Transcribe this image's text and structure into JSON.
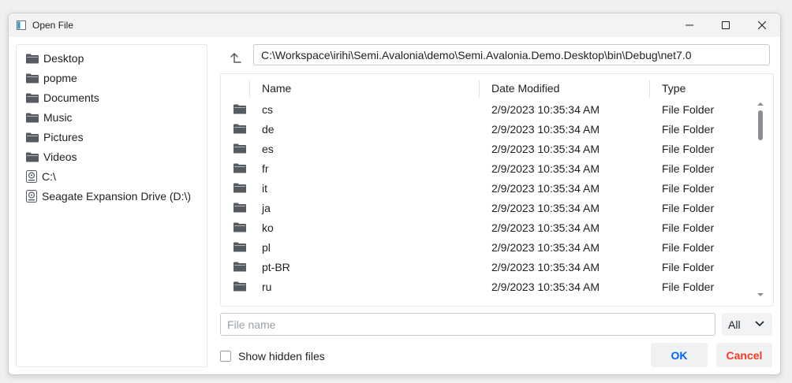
{
  "window": {
    "title": "Open File"
  },
  "sidebar": {
    "items": [
      {
        "label": "Desktop",
        "icon": "folder-icon"
      },
      {
        "label": "popme",
        "icon": "folder-icon"
      },
      {
        "label": "Documents",
        "icon": "folder-icon"
      },
      {
        "label": "Music",
        "icon": "folder-icon"
      },
      {
        "label": "Pictures",
        "icon": "folder-icon"
      },
      {
        "label": "Videos",
        "icon": "folder-icon"
      },
      {
        "label": "C:\\",
        "icon": "drive-icon"
      },
      {
        "label": "Seagate Expansion Drive (D:\\)",
        "icon": "drive-icon"
      }
    ]
  },
  "path": {
    "value": "C:\\Workspace\\irihi\\Semi.Avalonia\\demo\\Semi.Avalonia.Demo.Desktop\\bin\\Debug\\net7.0"
  },
  "list": {
    "columns": {
      "name": "Name",
      "date": "Date Modified",
      "type": "Type"
    },
    "rows": [
      {
        "name": "cs",
        "date": "2/9/2023 10:35:34 AM",
        "type": "File Folder"
      },
      {
        "name": "de",
        "date": "2/9/2023 10:35:34 AM",
        "type": "File Folder"
      },
      {
        "name": "es",
        "date": "2/9/2023 10:35:34 AM",
        "type": "File Folder"
      },
      {
        "name": "fr",
        "date": "2/9/2023 10:35:34 AM",
        "type": "File Folder"
      },
      {
        "name": "it",
        "date": "2/9/2023 10:35:34 AM",
        "type": "File Folder"
      },
      {
        "name": "ja",
        "date": "2/9/2023 10:35:34 AM",
        "type": "File Folder"
      },
      {
        "name": "ko",
        "date": "2/9/2023 10:35:34 AM",
        "type": "File Folder"
      },
      {
        "name": "pl",
        "date": "2/9/2023 10:35:34 AM",
        "type": "File Folder"
      },
      {
        "name": "pt-BR",
        "date": "2/9/2023 10:35:34 AM",
        "type": "File Folder"
      },
      {
        "name": "ru",
        "date": "2/9/2023 10:35:34 AM",
        "type": "File Folder"
      }
    ]
  },
  "filename": {
    "placeholder": "File name",
    "value": ""
  },
  "filter": {
    "selected": "All"
  },
  "options": {
    "show_hidden_label": "Show hidden files",
    "show_hidden_checked": false
  },
  "buttons": {
    "ok": "OK",
    "cancel": "Cancel"
  },
  "colors": {
    "accent": "#0064fa",
    "danger": "#f93920",
    "icon": "#555b61"
  }
}
